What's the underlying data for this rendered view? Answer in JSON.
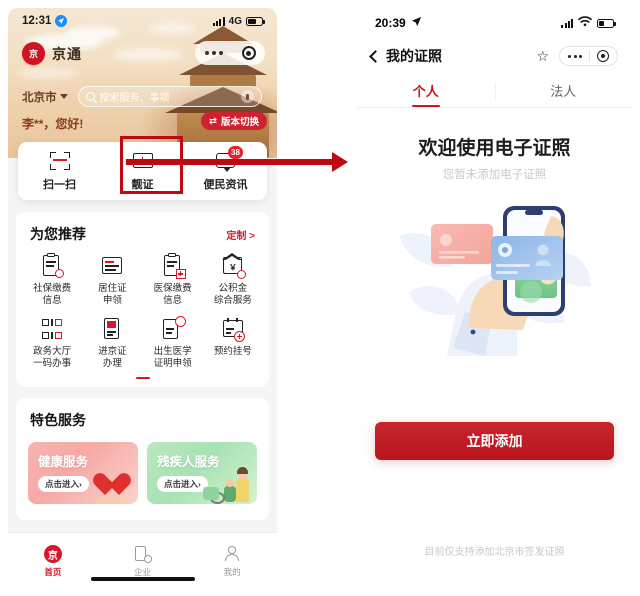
{
  "left_phone": {
    "status_bar": {
      "time": "12:31",
      "network": "4G",
      "location_icon": "location-arrow-icon"
    },
    "header": {
      "brand_name": "京通",
      "brand_logo_glyph": "京",
      "city": "北京市",
      "search_placeholder": "搜索服务、事项",
      "greeting": "李**，您好!",
      "version_switch": "版本切换",
      "version_switch_icon": "swap-icon"
    },
    "quick_actions": [
      {
        "label": "扫一扫",
        "icon": "scan-icon",
        "badge": ""
      },
      {
        "label": "靓证",
        "icon": "card-icon",
        "badge": ""
      },
      {
        "label": "便民资讯",
        "icon": "message-icon",
        "badge": "38"
      }
    ],
    "recommend": {
      "title": "为您推荐",
      "more": "定制 >",
      "items": [
        {
          "label": "社保缴费\n信息",
          "icon": "clipboard-social-icon"
        },
        {
          "label": "居住证\n申领",
          "icon": "document-lines-icon"
        },
        {
          "label": "医保缴费\n信息",
          "icon": "clipboard-medical-icon"
        },
        {
          "label": "公积金\n综合服务",
          "icon": "house-fund-icon"
        },
        {
          "label": "政务大厅\n一码办事",
          "icon": "qr-code-icon"
        },
        {
          "label": "进京证\n办理",
          "icon": "permit-icon"
        },
        {
          "label": "出生医学\n证明申领",
          "icon": "birth-certificate-icon"
        },
        {
          "label": "预约挂号",
          "icon": "calendar-plus-icon"
        }
      ]
    },
    "featured": {
      "title": "特色服务",
      "cards": [
        {
          "title": "健康服务",
          "button": "点击进入›",
          "theme": "#f2a7a3"
        },
        {
          "title": "残疾人服务",
          "button": "点击进入›",
          "theme": "#a9e3b5"
        }
      ]
    },
    "bottom_nav": [
      {
        "label": "首页",
        "icon": "home-icon",
        "active": true
      },
      {
        "label": "企业",
        "icon": "enterprise-icon",
        "active": false
      },
      {
        "label": "我的",
        "icon": "person-icon",
        "active": false
      }
    ]
  },
  "annotation": {
    "highlight_target": "靓证",
    "arrow_color": "#c00813",
    "arrow_direction": "right"
  },
  "right_phone": {
    "status_bar": {
      "time": "20:39",
      "location_icon": "location-arrow-icon",
      "wifi_icon": "wifi-icon"
    },
    "nav": {
      "back_icon": "back-chevron-icon",
      "title": "我的证照",
      "star_icon": "star-icon",
      "more_icon": "more-dots-icon",
      "target_icon": "target-icon"
    },
    "tabs": [
      {
        "label": "个人",
        "selected": true
      },
      {
        "label": "法人",
        "selected": false
      }
    ],
    "empty_state": {
      "heading": "欢迎使用电子证照",
      "subtext": "您暂未添加电子证照",
      "illustration": "hand-holding-phone-with-id-card"
    },
    "cta_button": "立即添加",
    "footer_note": "目前仅支持添加北京市签发证照"
  },
  "colors": {
    "brand_red": "#c8161d",
    "accent_red": "#d7182a",
    "arrow_red": "#c00813",
    "muted_gray": "#c9c9c9"
  }
}
